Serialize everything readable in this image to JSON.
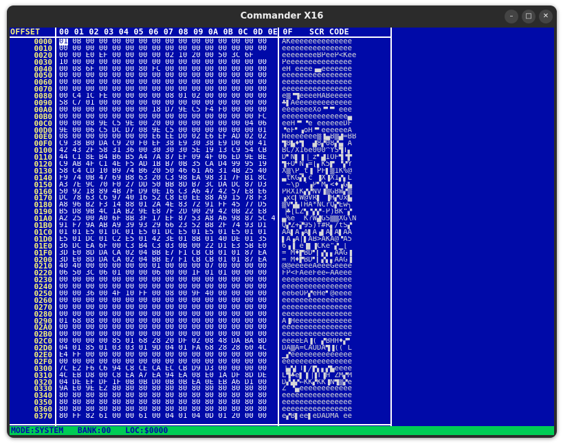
{
  "window": {
    "title": "Commander X16",
    "minimize_icon": "–",
    "maximize_icon": "□",
    "close_icon": "✕"
  },
  "header": {
    "offset_label": "OFFSET",
    "hex_label": "00 01 02 03 04 05 06 07 08 09 0A 0B 0C 0D 0E 0F",
    "scr_label": "SCR CODE"
  },
  "cursor_byte": "01",
  "rows": [
    {
      "offset": "0000",
      "bytes": "01 0B 00 00 00 00 00 00 00 00 00 00 00 00 00 00",
      "scr": "AKeeeeeeeeeeeeee"
    },
    {
      "offset": "0010",
      "bytes": "00 00 00 00 00 00 00 00 00 00 00 00 00 00 00 00",
      "scr": "eeeeeeeeeeeeeeee"
    },
    {
      "offset": "0020",
      "bytes": "00 00 E0 EF 00 00 00 00 02 10 20 00 50 3C 6F",
      "scr": "eeeeeeeeBPeeP<Kee"
    },
    {
      "offset": "0030",
      "bytes": "10 00 00 00 00 00 00 00 00 00 00 00 00 00 00 00",
      "scr": "Peeeeeeeeeeeeeee"
    },
    {
      "offset": "0040",
      "bytes": "00 08 6F 00 00 00 80 FC 00 00 00 00 00 00 00 00",
      "scr": "eH_eeee▗▄eeeeeee"
    },
    {
      "offset": "0050",
      "bytes": "00 00 00 00 00 00 00 00 00 00 00 00 00 00 00 00",
      "scr": "eeeeeeeeeeeeeeee"
    },
    {
      "offset": "0060",
      "bytes": "00 00 00 00 00 00 00 00 00 00 00 00 00 00 00 00",
      "scr": "eeeeeeeeeeeeeeee"
    },
    {
      "offset": "0070",
      "bytes": "00 00 00 00 00 00 00 00 00 00 00 00 00 00 00 00",
      "scr": "eeeeeeeeeeeeeeee"
    },
    {
      "offset": "0080",
      "bytes": "00 C4 1C FE 00 00 00 00 08 01 02 00 00 00 00 00",
      "scr": "e▒▝▜eeeeHABeeeee"
    },
    {
      "offset": "0090",
      "bytes": "58 C7 01 00 00 00 00 00 00 00 00 00 00 00 00 00",
      "scr": "♣▌Aeeeeeeeeeeeee"
    },
    {
      "offset": "00A0",
      "bytes": "00 00 00 00 00 00 00 18 D7 9E C5 F4 F0 00 00 00",
      "scr": "eeeeeeeXo▝▘▀▔eee"
    },
    {
      "offset": "00B0",
      "bytes": "00 00 00 00 00 00 00 00 00 00 00 00 00 00 00 FC",
      "scr": "eeeeeeeeeeeeeee▄"
    },
    {
      "offset": "00C0",
      "bytes": "00 00 08 9E C5 9E 00 20 00 00 00 00 00 00 04 06",
      "scr": "eeH▝▘▝e eeeeeeDF"
    },
    {
      "offset": "00D0",
      "bytes": "9E 00 06 C5 DC D7 08 9E C5 00 00 00 00 00 00 01",
      "scr": "▝eF▘▗oH▝▘eeeeeeA"
    },
    {
      "offset": "00E0",
      "bytes": "08 00 00 00 00 00 00 E6 EE D0 02 E6 EF AD 02 02",
      "scr": "Heeeeeee▒▐▄B▒▟=BB"
    },
    {
      "offset": "00F0",
      "bytes": "C9 38 B0 DA C9 20 F0 EF 38 E9 30 38 E9 D0 60 41",
      "scr": "▜8▙♦▜ ▔▟8▞08▞▄ A"
    },
    {
      "offset": "0100",
      "bytes": "42 43 2F 58 31 36 00 30 30 30 5E 19 13 C9 54 CB",
      "scr": "BC/X16e000^YS▜T▖"
    },
    {
      "offset": "0110",
      "bytes": "44 C1 8E B4 B6 B5 A4 7A 87 EF 09 4F 06 ED 9E BE",
      "scr": "D▘N▌▐▕_z▘▟IOF▜▝▛"
    },
    {
      "offset": "0120",
      "bytes": "C9 AB 4F C1 4E F5 AD 1B B7 0B 35 CA D4 99 95 19",
      "scr": "▜+O▘N▗=[▖K5▛▔▝▞Y"
    },
    {
      "offset": "0130",
      "bytes": "58 C4 CD 10 B9 74 B6 20 50 46 61 A6 31 4B 25 40",
      "scr": "X▒\\P▁t▐ PF▌▒1K%@"
    },
    {
      "offset": "0140",
      "bytes": "F9 74 0B 47 69 B8 63 20 C3 98 EA 98 31 7F B1 8C",
      "scr": "▃tKG▞▖c ▐X▐X1▞▖L"
    },
    {
      "offset": "0150",
      "bytes": "A3 7E 9C 70 F0 27 DD 50 BB 8D B7 3C DA DC 87 D3",
      "scr": "▔~\\p▔'▗P▘M▖<♦▗G▙"
    },
    {
      "offset": "0160",
      "bytes": "50 92 18 89 4B 7F D9 0E 16 C3 A6 47 42 57 E8 E6",
      "scr": "PRXIK▞▞NV▐▒GBW▞▒"
    },
    {
      "offset": "0170",
      "bytes": "DC 78 63 C6 97 40 16 52 C8 E0 EE 88 A9 15 78 F3",
      "scr": "▗xc▎W@VR▌ ▐H▞Ux▙"
    },
    {
      "offset": "0180",
      "bytes": "A8 96 B2 F3 14 88 01 2A 4E 83 72 91 FF 45 77 D5",
      "scr": "▒V▚▙THA*NCrQ▞Ew╮"
    },
    {
      "offset": "0190",
      "bytes": "B5 D8 9B 4C 1A B2 9E E8 7F 2D 90 29 42 0B 22 E8",
      "scr": "▕♣[LZ▚▝▞▞-P)BK\"▞"
    },
    {
      "offset": "01A0",
      "bytes": "A2 25 00 A0 6F 8B 3F 17 EF 87 53 A8 A6 98 87 5C 4E",
      "scr": "▄%e _K?W▟GS▒▒XG\\N"
    },
    {
      "offset": "01B0",
      "bytes": "91 F7 9A AB A9 39 93 29 66 23 52 B8 2F 74 93 D1",
      "scr": "Q▞Z+▞9S)f#R▖/tS▞"
    },
    {
      "offset": "01C0",
      "bytes": "01 01 E5 01 DC 01 E5 01 DC E5 01 E5 01 E5 01 01",
      "scr": "AA▌A▗A▌A▗▌A▌A▌AA"
    },
    {
      "offset": "01D0",
      "bytes": "E5 01 DC 01 C2 E5 01 42 3E 01 8B 01 40 DE 01 35",
      "scr": "▌A▗A│▌AB>AKA@▝A5"
    },
    {
      "offset": "01E0",
      "bytes": "36 DC EA 6F 00 C3 B4 C3 03 0B 00 22 D1 E3 5B E0",
      "scr": "6▗▐_e▐▌▐CKe\"▞▁[ "
    },
    {
      "offset": "01F0",
      "bytes": "3D E0 8D DA CA 02 04 BB E7 F1 CB CB 01 01 87 EA",
      "scr": "= M♦▛BD▘▎▞▖▖AAG▐"
    },
    {
      "offset": "0200",
      "bytes": "3D E0 8D DA CA 02 04 BB E7 F1 CB CB 01 01 87 EA",
      "scr": "= M♦▛BD▘▎▞▖▖AAG▐"
    },
    {
      "offset": "0210",
      "bytes": "40 40 00 00 00 00 00 01 00 00 00 07 00 00 00 00",
      "scr": "@@eeeeeAeeeGeeee"
    },
    {
      "offset": "0220",
      "bytes": "06 50 3C 06 01 00 00 06 00 00 1F 01 01 00 00 00",
      "scr": "FP<FAeeFee←AAeee"
    },
    {
      "offset": "0230",
      "bytes": "00 00 00 00 00 00 00 00 00 00 00 00 00 00 00 00",
      "scr": "eeeeeeeeeeeeeeee"
    },
    {
      "offset": "0240",
      "bytes": "00 00 00 00 00 00 00 00 00 00 00 00 00 00 00 00",
      "scr": "eeeeeeeeeeeeeeee"
    },
    {
      "offset": "0250",
      "bytes": "00 00 36 00 4F 10 FF 00 08 00 9F 40 00 00 00 00",
      "scr": "ee6eOP▞eHe▘@eeee"
    },
    {
      "offset": "0260",
      "bytes": "00 00 00 00 00 00 00 00 00 00 00 00 00 00 00 00",
      "scr": "eeeeeeeeeeeeeeee"
    },
    {
      "offset": "0270",
      "bytes": "00 00 00 00 00 00 00 00 00 00 00 00 00 00 00 00",
      "scr": "eeeeeeeeeeeeeeee"
    },
    {
      "offset": "0280",
      "bytes": "00 00 00 00 00 00 00 00 00 00 00 00 00 00 00 00",
      "scr": "eeeeeeeeeeeeeeee"
    },
    {
      "offset": "0290",
      "bytes": "01 68 08 00 00 00 00 00 00 00 00 00 00 00 00 00",
      "scr": "A▐Heeeeeeeeeeeee"
    },
    {
      "offset": "02A0",
      "bytes": "00 00 00 00 00 00 00 00 00 00 00 00 00 00 00 00",
      "scr": "eeeeeeeeeeeeeeee"
    },
    {
      "offset": "02B0",
      "bytes": "00 00 00 00 00 00 00 00 00 00 00 00 00 00 00 00",
      "scr": "eeeeeeeeeeeeeeee"
    },
    {
      "offset": "02C0",
      "bytes": "00 00 00 00 85 01 68 28 20 DF 02 08 48 DA BA BD",
      "scr": "eeeeEA▐( ▞BHH♦▞▘"
    },
    {
      "offset": "02D0",
      "bytes": "04 01 85 01 03 03 01 9D 04 01 FA 68 28 28 60 4C",
      "scr": "DA▒A=CAUDA▜▐(( L"
    },
    {
      "offset": "02E0",
      "bytes": "E4 FF 00 00 00 00 00 00 00 00 00 00 00 00 00 00",
      "scr": "▁▞eeeeeeeeeeeeee"
    },
    {
      "offset": "02F0",
      "bytes": "00 00 00 00 00 00 00 00 00 00 00 00 00 00 00 00",
      "scr": "eeeeeeeeeeeeeeee"
    },
    {
      "offset": "0300",
      "bytes": "7C E2 F6 C6 94 C8 CE CA EC CB D9 D3 00 00 00 00",
      "scr": "▕▄▚▎T▌╱▛▖▖▞▙eeee"
    },
    {
      "offset": "0310",
      "bytes": "4C EB D8 00 C8 EA A7 EA 94 EA 08 E0 1A DF 8D DE",
      "scr": "L▜♣e▌▐▕▐T▐H ZM▞M"
    },
    {
      "offset": "0320",
      "bytes": "04 DE EF DF 1F 0B 0B D0 0B 0B EA 0E EB A6 D1 00",
      "scr": "D▞▟▞←KK▞KK▐N▜▒▞e"
    },
    {
      "offset": "0330",
      "bytes": "9A E0 9E E2 80 80 80 80 80 80 80 80 80 80 80 80",
      "scr": "Z ▝▄eeeeeeeeeeee"
    },
    {
      "offset": "0340",
      "bytes": "80 80 80 80 80 80 80 80 80 80 80 80 80 80 80 80",
      "scr": "eeeeeeeeeeeeeeee"
    },
    {
      "offset": "0350",
      "bytes": "80 80 80 80 80 80 80 80 80 80 80 80 80 80 80 80",
      "scr": "eeeeeeeeeeeeeeee"
    },
    {
      "offset": "0360",
      "bytes": "80 80 80 80 80 80 80 80 80 80 80 80 80 80 80 80",
      "scr": "eeeeeeeeeeeeeeee"
    },
    {
      "offset": "0370",
      "bytes": "80 FF 82 61 00 00 61 00 04 01 04 0D 01 20 00 00",
      "scr": "e▞B▌ee▌eDADMA ee"
    }
  ],
  "status": {
    "text": "MODE:SYSTEM   BANK:00   LOC:$0000"
  },
  "colors": {
    "screen_bg": "#000aa8",
    "offset_text": "#f6f07a",
    "hex_text": "#ffffff",
    "status_bg": "#00cc55",
    "status_text": "#000aa8"
  }
}
